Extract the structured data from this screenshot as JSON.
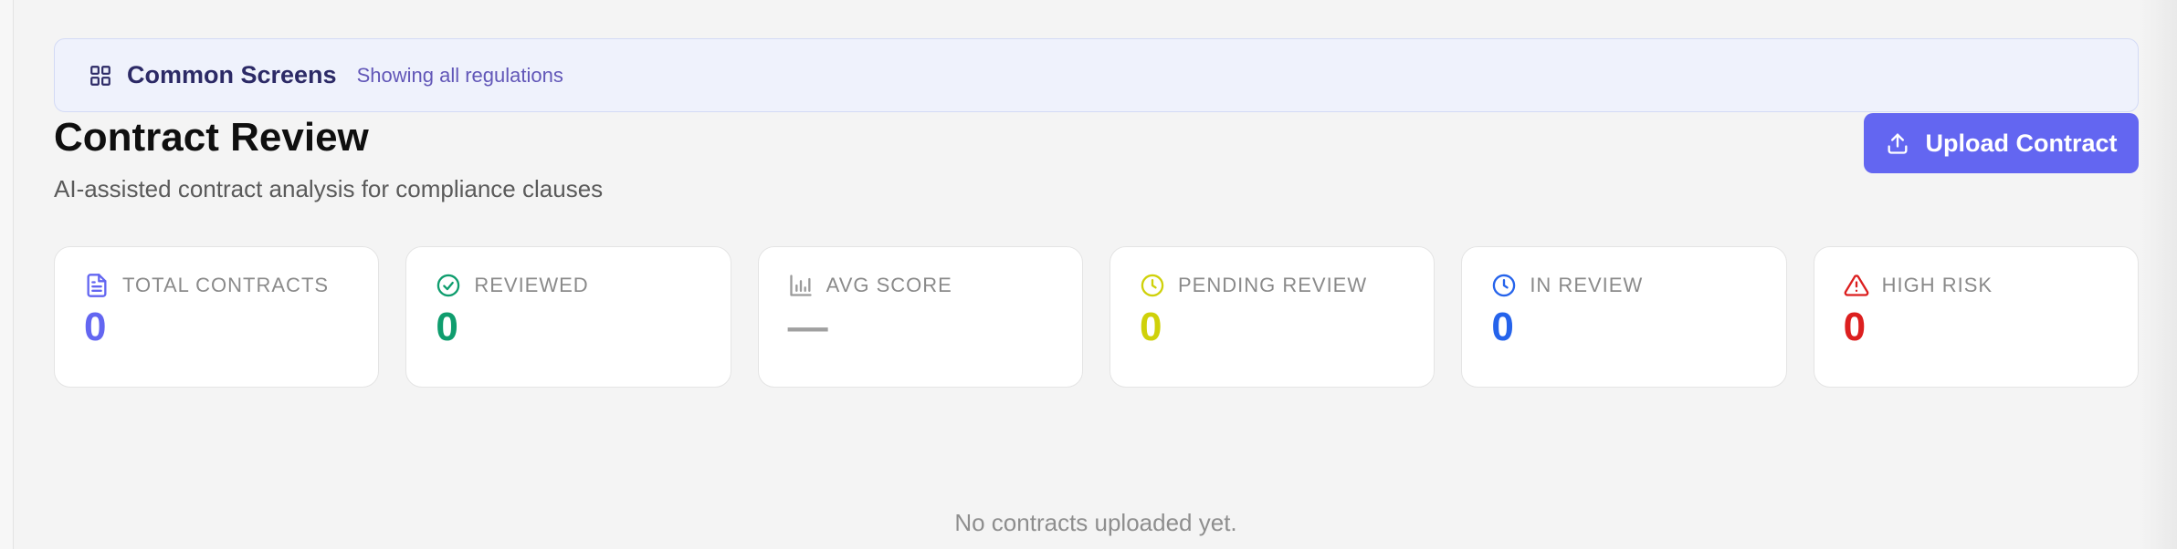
{
  "filter": {
    "title": "Common Screens",
    "subtitle": "Showing all regulations",
    "icon": "grid-icon"
  },
  "header": {
    "title": "Contract Review",
    "subtitle": "AI-assisted contract analysis for compliance clauses",
    "upload_label": "Upload Contract",
    "upload_icon": "upload-icon"
  },
  "stats": [
    {
      "label": "TOTAL CONTRACTS",
      "value": "0",
      "icon": "document-icon",
      "color": "#6366f1"
    },
    {
      "label": "REVIEWED",
      "value": "0",
      "icon": "check-circle-icon",
      "color": "#0f9d6e"
    },
    {
      "label": "AVG SCORE",
      "value": "—",
      "icon": "bar-chart-icon",
      "color": "#a0a0a0"
    },
    {
      "label": "PENDING REVIEW",
      "value": "0",
      "icon": "clock-icon",
      "color": "#cfd10a"
    },
    {
      "label": "IN REVIEW",
      "value": "0",
      "icon": "clock-icon",
      "color": "#2563eb"
    },
    {
      "label": "HIGH RISK",
      "value": "0",
      "icon": "warning-icon",
      "color": "#dc1f1f"
    }
  ],
  "empty_state": {
    "message": "No contracts uploaded yet."
  }
}
